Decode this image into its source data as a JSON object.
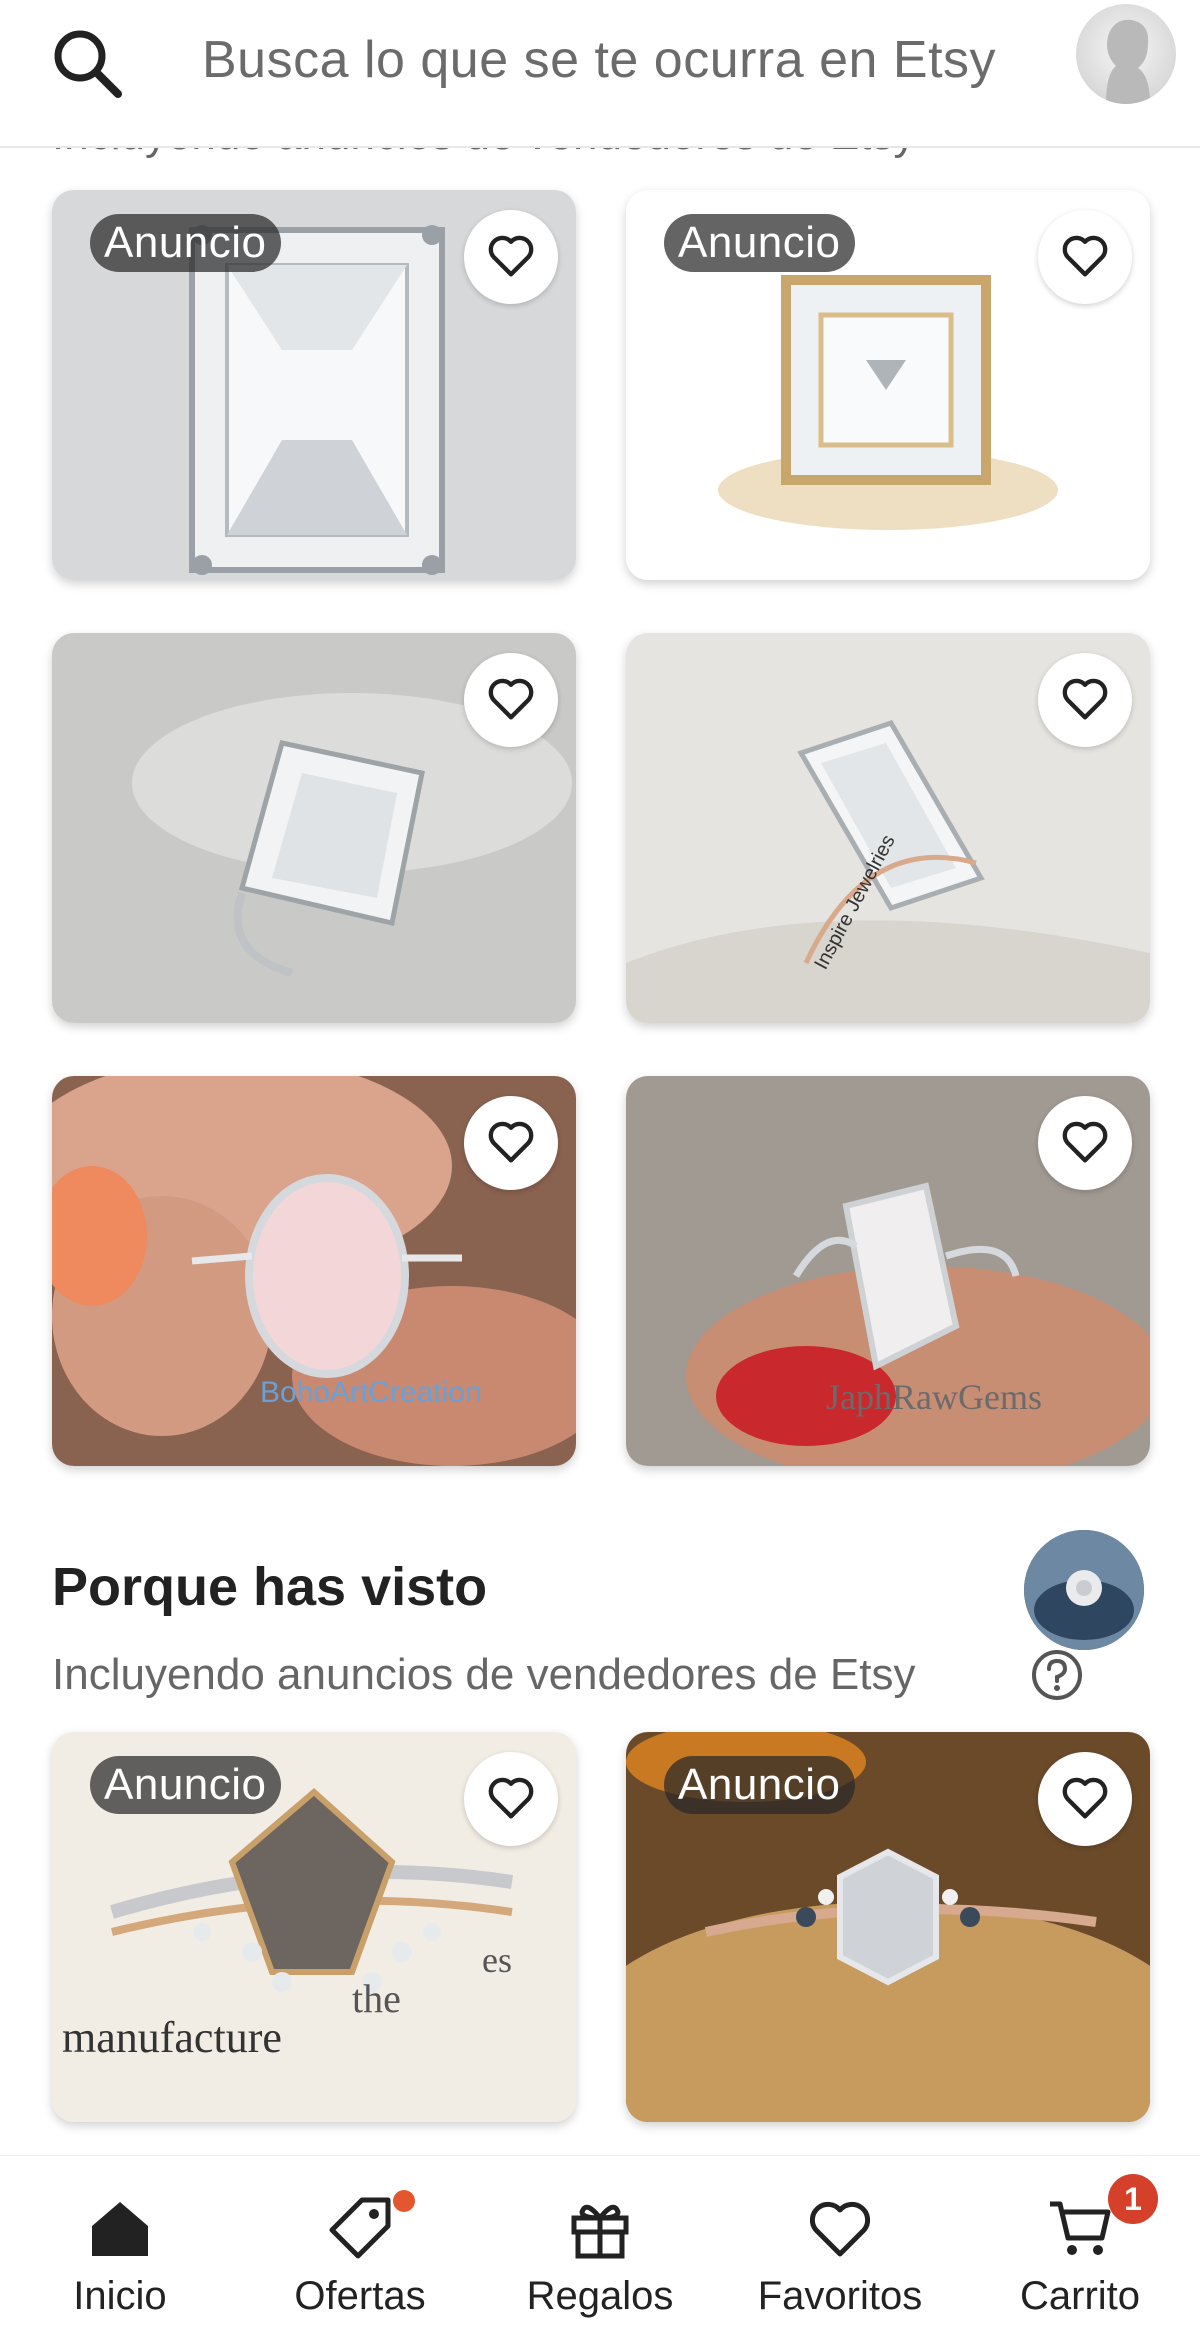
{
  "header": {
    "search_placeholder": "Busca lo que se te ocurra en Etsy",
    "partial_subtitle": "Incluyendo anuncios de vendedores de Etsy"
  },
  "grid": {
    "ad_label": "Anuncio",
    "watermarks": {
      "card4": "Inspire Jewelries",
      "card5": "BohoArtCreation",
      "card6": "JaphRawGems"
    }
  },
  "section": {
    "title": "Porque has visto",
    "subtitle": "Incluyendo anuncios de vendedores de Etsy"
  },
  "card7_text": [
    "manufacture",
    "the",
    "es"
  ],
  "nav": {
    "items": [
      {
        "label": "Inicio",
        "icon": "home-icon"
      },
      {
        "label": "Ofertas",
        "icon": "tag-icon"
      },
      {
        "label": "Regalos",
        "icon": "gift-icon"
      },
      {
        "label": "Favoritos",
        "icon": "heart-icon"
      },
      {
        "label": "Carrito",
        "icon": "cart-icon"
      }
    ],
    "cart_count": "1"
  },
  "colors": {
    "badge_bg": "#3a3a3a",
    "notification": "#d4402a",
    "text": "#222222",
    "muted": "#666666"
  }
}
